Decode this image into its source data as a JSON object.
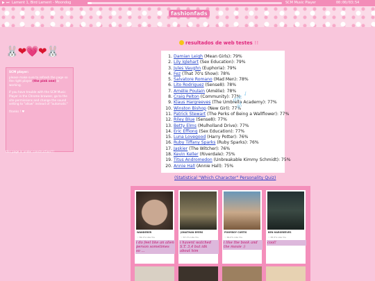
{
  "player": {
    "track": "Lament 1, Bird Lament - Moondog",
    "name": "SCM Music Player",
    "time": "00:00/03:54",
    "progress": 0.02
  },
  "header": {
    "logo": "fashionfads"
  },
  "sidebar": {
    "art": "🐰❤💗❤🐰",
    "box_title": "SCM player:",
    "box_text_1": "please make sure to refresh the page so the right player",
    "box_link": "(the pink one)",
    "box_text_2": "is working.",
    "box_text_3": "if you have trouble with the SCM Music Player in the Chrome browser, go to the site permissions and change the sound setting to \"allow\" instead of \"automatic\"",
    "box_sign": "thanks ! ♥",
    "note": "this page is under construction!!!"
  },
  "main": {
    "title": "resultados de web testes",
    "title_suffix": "!!",
    "scribble": "me ✓ af",
    "results": [
      {
        "rank": "1.",
        "name": "Damian Leigh",
        "rest": " (Mean Girls): 79%"
      },
      {
        "rank": "2.",
        "name": "Lily Iglehart",
        "rest": " (Sex Education): 79%"
      },
      {
        "rank": "3.",
        "name": "Jules Vaughn",
        "rest": " (Euphoria): 79%"
      },
      {
        "rank": "4.",
        "name": "Fez",
        "rest": " (That 70's Show): 78%"
      },
      {
        "rank": "5.",
        "name": "Salvatore Romano",
        "rest": " (Mad Men): 78%"
      },
      {
        "rank": "6.",
        "name": "Lito Rodriguez",
        "rest": " (Sense8): 78%"
      },
      {
        "rank": "7.",
        "name": "Amélie Poulain",
        "rest": " (Amélie): 78%"
      },
      {
        "rank": "8.",
        "name": "Craig Pelton",
        "rest": " (Community): 77%"
      },
      {
        "rank": "9.",
        "name": "Klaus Hargreeves",
        "rest": " (The Umbrella Academy): 77%"
      },
      {
        "rank": "10.",
        "name": "Winston Bishop",
        "rest": " (New Girl): 77%"
      },
      {
        "rank": "11.",
        "name": "Patrick Stewart",
        "rest": " (The Perks of Being a Wallflower): 77%"
      },
      {
        "rank": "12.",
        "name": "Riley Blue",
        "rest": " (Sense8): 77%"
      },
      {
        "rank": "13.",
        "name": "Betty Elms",
        "rest": " (Mulholland Drive): 77%"
      },
      {
        "rank": "14.",
        "name": "Eric Effiong",
        "rest": " (Sex Education): 77%"
      },
      {
        "rank": "15.",
        "name": "Luna Lovegood",
        "rest": " (Harry Potter): 76%"
      },
      {
        "rank": "16.",
        "name": "Ruby Tiffany Sparks",
        "rest": " (Ruby Sparks): 76%"
      },
      {
        "rank": "17.",
        "name": "Jaskier",
        "rest": " (The Witcher): 76%"
      },
      {
        "rank": "18.",
        "name": "Kevin Keller",
        "rest": " (Riverdale): 75%"
      },
      {
        "rank": "19.",
        "name": "Titus Andromedon",
        "rest": " (Unbreakable Kimmy Schmidt): 75%"
      },
      {
        "rank": "20.",
        "name": "Annie Hall",
        "rest": " (Annie Hall): 75%"
      }
    ],
    "quiz_link": "(Statistical \"Which Character\" Personality Quiz)"
  },
  "panel": {
    "cards": [
      {
        "caption": "WANDERER",
        "sub": "♡ 69.1% Like You",
        "note": "i do feel like an alien person sometimes so ..."
      },
      {
        "caption": "JONATHAN BYERS",
        "sub": "♡ 67.1% Like You",
        "note": "i havent watched S.T. 3,4 but idk about him"
      },
      {
        "caption": "PONYBOY CURTIS",
        "sub": "♡ 66.0% Like You",
        "note": "i like the book and the movie :)"
      },
      {
        "caption": "BEN HARGREEVES",
        "sub": "♡ 65.5% Like You",
        "note": "cool!"
      }
    ],
    "colors": {
      "panel": "#f48fbb",
      "note_bg": "#ddb8dc",
      "note_text": "#c0186d"
    }
  }
}
